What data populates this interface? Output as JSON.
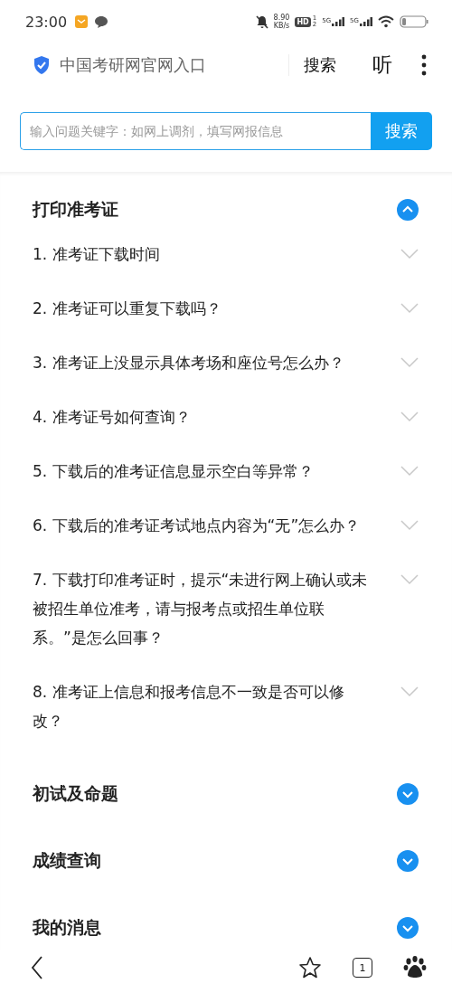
{
  "status_bar": {
    "time": "23:00",
    "speed": "8.90",
    "speed_unit": "KB/s",
    "hd": "HD",
    "hd_sims": [
      "1",
      "2"
    ],
    "networks": [
      "5G",
      "5G"
    ]
  },
  "header": {
    "title": "中国考研网官网入口",
    "search": "搜索",
    "listen": "听"
  },
  "search": {
    "placeholder": "输入问题关键字：如网上调剂，填写网报信息",
    "button": "搜索"
  },
  "sections": [
    {
      "title": "打印准考证",
      "expanded": true,
      "items": [
        {
          "text": "1. 准考证下载时间",
          "expanded": false
        },
        {
          "text": "2. 准考证可以重复下载吗？",
          "expanded": false
        },
        {
          "text": "3. 准考证上没显示具体考场和座位号怎么办？",
          "expanded": false
        },
        {
          "text": "4. 准考证号如何查询？",
          "expanded": false
        },
        {
          "text": "5. 下载后的准考证信息显示空白等异常？",
          "expanded": false
        },
        {
          "text": "6. 下载后的准考证考试地点内容为“无”怎么办？",
          "expanded": false
        },
        {
          "text": "7. 下载打印准考证时，提示“未进行网上确认或未被招生单位准考，请与报考点或招生单位联系。”是怎么回事？",
          "expanded": false
        },
        {
          "text": "8. 准考证上信息和报考信息不一致是否可以修改？",
          "expanded": false
        }
      ]
    },
    {
      "title": "初试及命题",
      "expanded": false
    },
    {
      "title": "成绩查询",
      "expanded": false
    },
    {
      "title": "我的消息",
      "expanded": false
    }
  ],
  "bottom_bar": {
    "tab_count": "1"
  }
}
